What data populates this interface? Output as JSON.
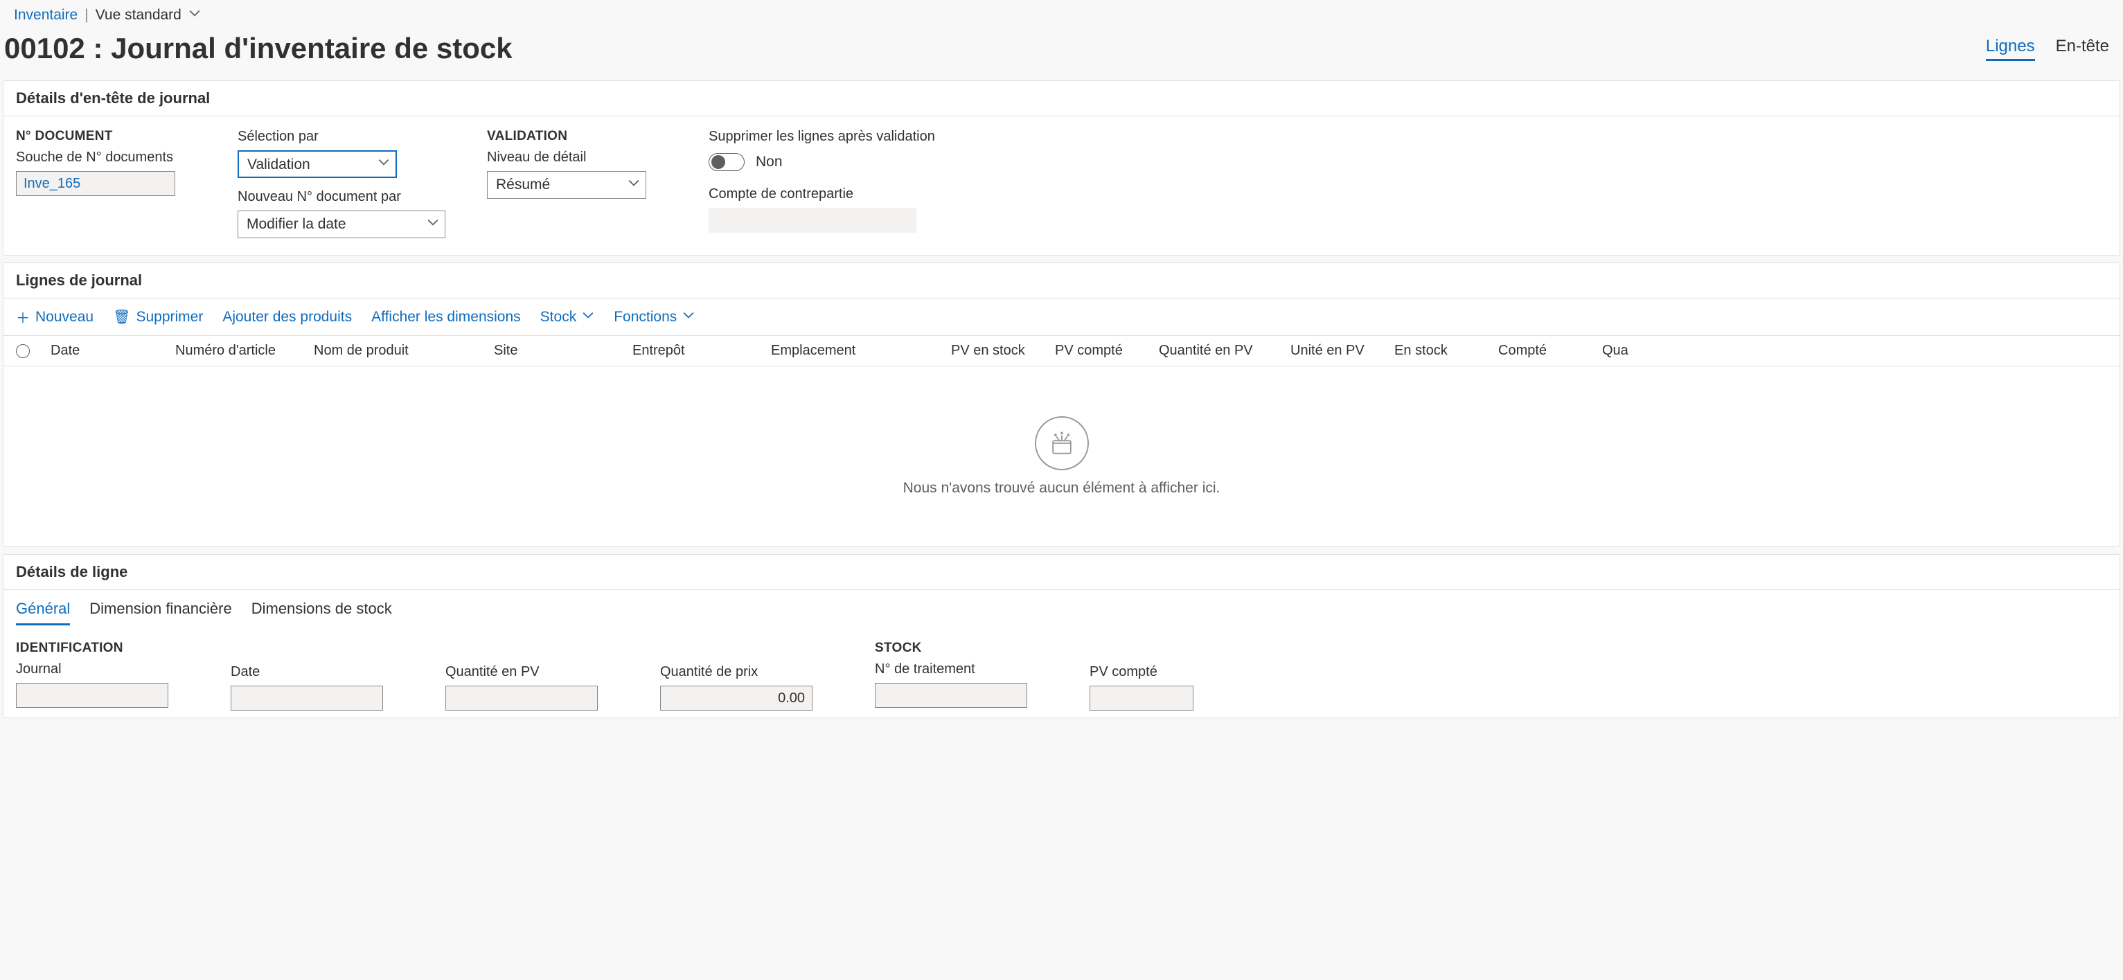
{
  "breadcrumb": {
    "root": "Inventaire",
    "view_label": "Vue standard"
  },
  "title": "00102 : Journal d'inventaire de stock",
  "view_tabs": {
    "lines": "Lignes",
    "header": "En-tête"
  },
  "header_section": {
    "title": "Détails d'en-tête de journal",
    "doc_group": "N° DOCUMENT",
    "souche_label": "Souche de N° documents",
    "souche_value": "Inve_165",
    "selection_label": "Sélection par",
    "selection_value": "Validation",
    "newdoc_label": "Nouveau N° document par",
    "newdoc_value": "Modifier la date",
    "validation_group": "VALIDATION",
    "detail_label": "Niveau de détail",
    "detail_value": "Résumé",
    "delete_label": "Supprimer les lignes après validation",
    "delete_value_text": "Non",
    "offset_label": "Compte de contrepartie"
  },
  "lines_section": {
    "title": "Lignes de journal",
    "toolbar": {
      "new": "Nouveau",
      "delete": "Supprimer",
      "add_products": "Ajouter des produits",
      "display_dims": "Afficher les dimensions",
      "stock": "Stock",
      "functions": "Fonctions"
    },
    "columns": {
      "date": "Date",
      "item": "Numéro d'article",
      "product": "Nom de produit",
      "site": "Site",
      "warehouse": "Entrepôt",
      "location": "Emplacement",
      "pv_stock": "PV en stock",
      "pv_counted": "PV compté",
      "qty_pv": "Quantité en PV",
      "unit_pv": "Unité en PV",
      "in_stock": "En stock",
      "counted": "Compté",
      "qty": "Qua"
    },
    "empty_text": "Nous n'avons trouvé aucun élément à afficher ici."
  },
  "line_details": {
    "title": "Détails de ligne",
    "tabs": {
      "general": "Général",
      "findim": "Dimension financière",
      "stockdim": "Dimensions de stock"
    },
    "identification_group": "IDENTIFICATION",
    "journal_label": "Journal",
    "date_label": "Date",
    "qty_pv_label": "Quantité en PV",
    "price_qty_label": "Quantité de prix",
    "price_qty_value": "0.00",
    "stock_group": "STOCK",
    "lot_label": "N° de traitement",
    "pv_counted_label": "PV compté"
  }
}
